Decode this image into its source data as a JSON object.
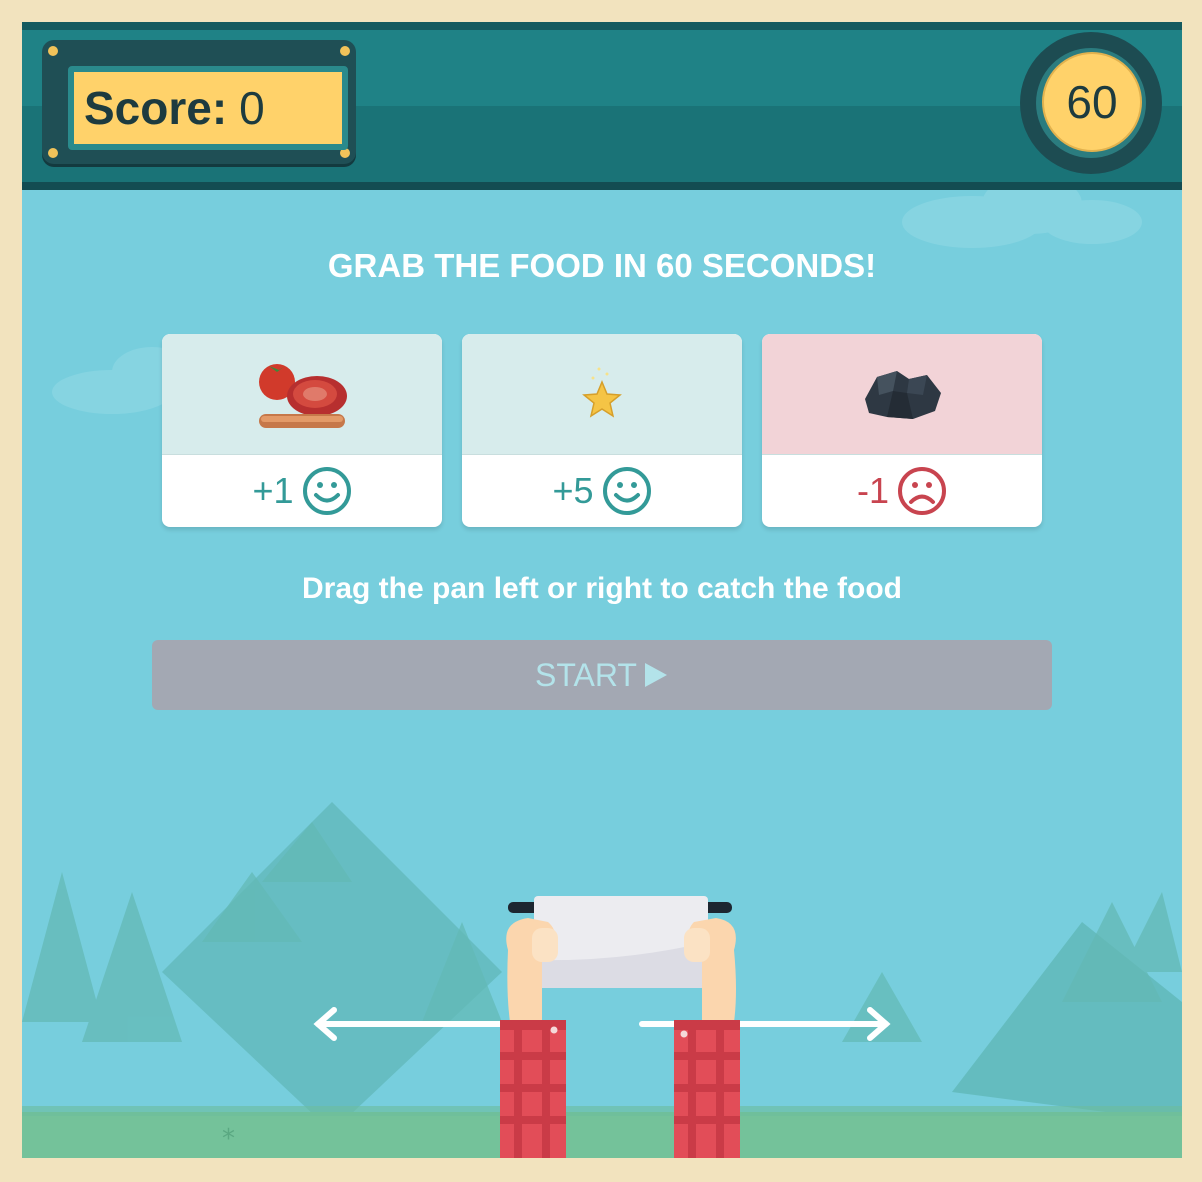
{
  "header": {
    "score_label": "Score:",
    "score_value": "0",
    "timer_value": "60"
  },
  "instructions": {
    "title": "GRAB THE FOOD IN 60 SECONDS!",
    "hint": "Drag the pan left or right to catch the food"
  },
  "cards": [
    {
      "value": "+1",
      "mood": "happy",
      "item": "food-icon"
    },
    {
      "value": "+5",
      "mood": "happy",
      "item": "star-icon"
    },
    {
      "value": "-1",
      "mood": "sad",
      "item": "coal-icon"
    }
  ],
  "start_button": {
    "label": "START",
    "icon": "play-icon"
  },
  "colors": {
    "positive": "#339a98",
    "negative": "#c8444f",
    "accent": "#ffd26a"
  }
}
